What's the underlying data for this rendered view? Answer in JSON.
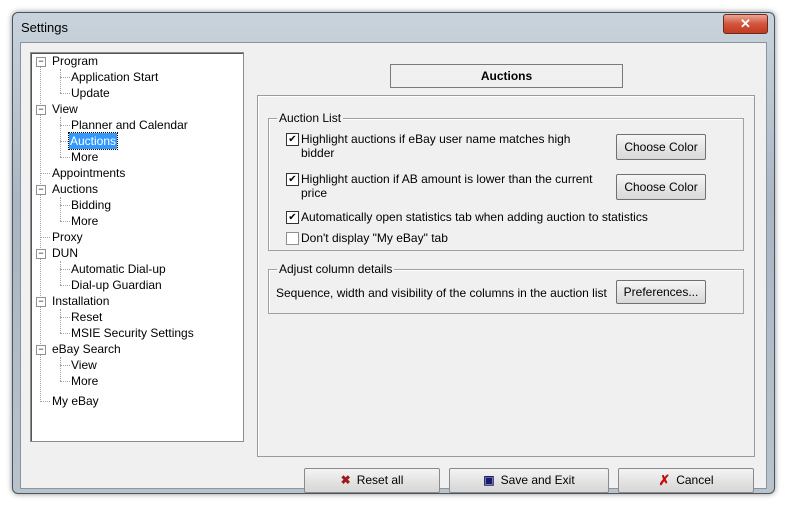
{
  "window": {
    "title": "Settings",
    "close_glyph": "✕"
  },
  "tree": {
    "items": [
      {
        "label": "Program"
      },
      {
        "label": "Application Start"
      },
      {
        "label": "Update"
      },
      {
        "label": "View"
      },
      {
        "label": "Planner and Calendar"
      },
      {
        "label": "Auctions"
      },
      {
        "label": "More"
      },
      {
        "label": "Appointments"
      },
      {
        "label": "Auctions"
      },
      {
        "label": "Bidding"
      },
      {
        "label": "More"
      },
      {
        "label": "Proxy"
      },
      {
        "label": "DUN"
      },
      {
        "label": "Automatic Dial-up"
      },
      {
        "label": "Dial-up Guardian"
      },
      {
        "label": "Installation"
      },
      {
        "label": "Reset"
      },
      {
        "label": "MSIE Security Settings"
      },
      {
        "label": "eBay Search"
      },
      {
        "label": "View"
      },
      {
        "label": "More"
      },
      {
        "label": "My eBay"
      }
    ],
    "expander_glyph": "−"
  },
  "header": {
    "title": "Auctions"
  },
  "auction_list": {
    "label": "Auction List",
    "options": [
      {
        "line1": "Highlight auctions if eBay user name matches high",
        "line2": "bidder",
        "checked": true
      },
      {
        "line1": "Highlight auction if AB amount is lower than the current",
        "line2": "price",
        "checked": true
      },
      {
        "line1": "Automatically open statistics tab when adding auction to statistics",
        "line2": "",
        "checked": true
      },
      {
        "line1": "Don't display \"My eBay\" tab",
        "line2": "",
        "checked": false
      }
    ],
    "choose_color_1": "Choose Color",
    "choose_color_2": "Choose Color"
  },
  "columns": {
    "label": "Adjust column details",
    "description": "Sequence, width and visibility of the columns in the auction list",
    "preferences_label": "Preferences..."
  },
  "buttons": {
    "reset_all": "Reset all",
    "save_exit": "Save and Exit",
    "cancel": "Cancel"
  },
  "check_glyph": "✔"
}
